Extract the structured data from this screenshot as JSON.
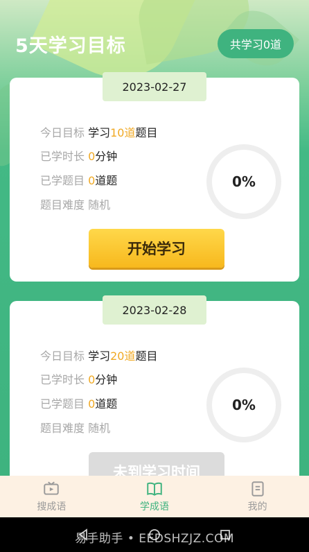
{
  "header": {
    "title": "5天学习目标",
    "total_badge": "共学习0道"
  },
  "cards": [
    {
      "date": "2023-02-27",
      "goal_label": "今日目标",
      "goal_prefix": "学习",
      "goal_count": "10道",
      "goal_suffix": "题目",
      "duration_label": "已学时长",
      "duration_value": "0",
      "duration_unit": "分钟",
      "learned_label": "已学题目",
      "learned_value": "0",
      "learned_unit": "道题",
      "difficulty_label": "题目难度",
      "difficulty_value": "随机",
      "progress_text": "0%",
      "progress": 0,
      "button_label": "开始学习"
    },
    {
      "date": "2023-02-28",
      "goal_label": "今日目标",
      "goal_prefix": "学习",
      "goal_count": "20道",
      "goal_suffix": "题目",
      "duration_label": "已学时长",
      "duration_value": "0",
      "duration_unit": "分钟",
      "learned_label": "已学题目",
      "learned_value": "0",
      "learned_unit": "道题",
      "difficulty_label": "题目难度",
      "difficulty_value": "随机",
      "progress_text": "0%",
      "progress": 0,
      "button_label": "未到学习时间"
    }
  ],
  "tabs": [
    {
      "label": "搜成语",
      "icon": "tv-icon",
      "active": false
    },
    {
      "label": "学成语",
      "icon": "book-icon",
      "active": true
    },
    {
      "label": "我的",
      "icon": "document-icon",
      "active": false
    }
  ],
  "watermark": "易手助手 • EEDSHZJZ.COM",
  "colors": {
    "accent": "#3fb37f",
    "highlight": "#f0a924",
    "button": "#f7b81d"
  }
}
